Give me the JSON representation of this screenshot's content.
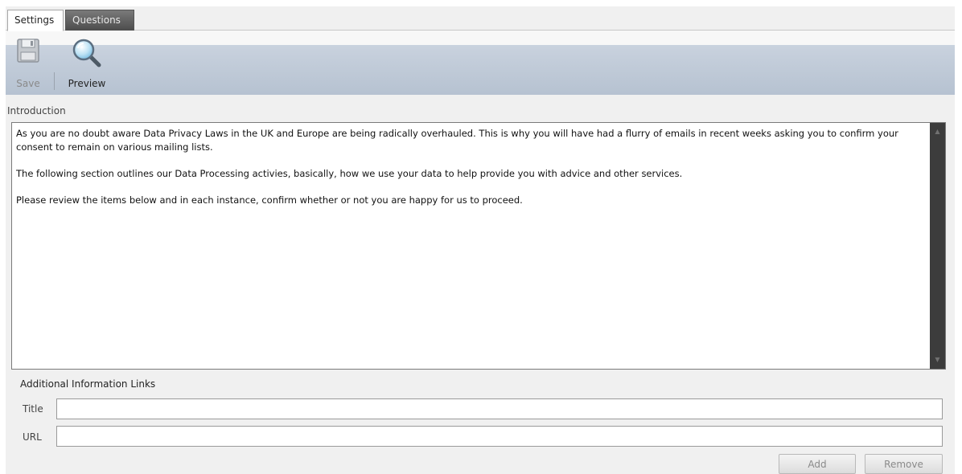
{
  "tabs": [
    {
      "label": "Settings",
      "active": true
    },
    {
      "label": "Questions",
      "active": false
    }
  ],
  "toolbar": {
    "save_label": "Save",
    "save_icon": "floppy-disk-icon",
    "preview_label": "Preview",
    "preview_icon": "magnifier-icon"
  },
  "introduction": {
    "label": "Introduction",
    "paragraphs": [
      "As you are no doubt aware Data Privacy Laws in the UK and Europe are being radically overhauled.  This is why you will have had a flurry of emails in recent weeks asking you to confirm your consent to remain on various mailing lists.",
      "The following section outlines our Data Processing activies, basically, how we use your data to help provide you with advice and other services.",
      "Please review the items below and in each instance, confirm whether or not you are happy for us to proceed."
    ]
  },
  "links": {
    "heading": "Additional Information Links",
    "title_label": "Title",
    "title_value": "",
    "url_label": "URL",
    "url_value": "",
    "add_label": "Add",
    "remove_label": "Remove"
  },
  "colors": {
    "toolbar_band": "#c0cad8",
    "scrollbar": "#3c3c3c",
    "active_tab": "#ffffff",
    "inactive_tab": "#5e5e5e"
  }
}
